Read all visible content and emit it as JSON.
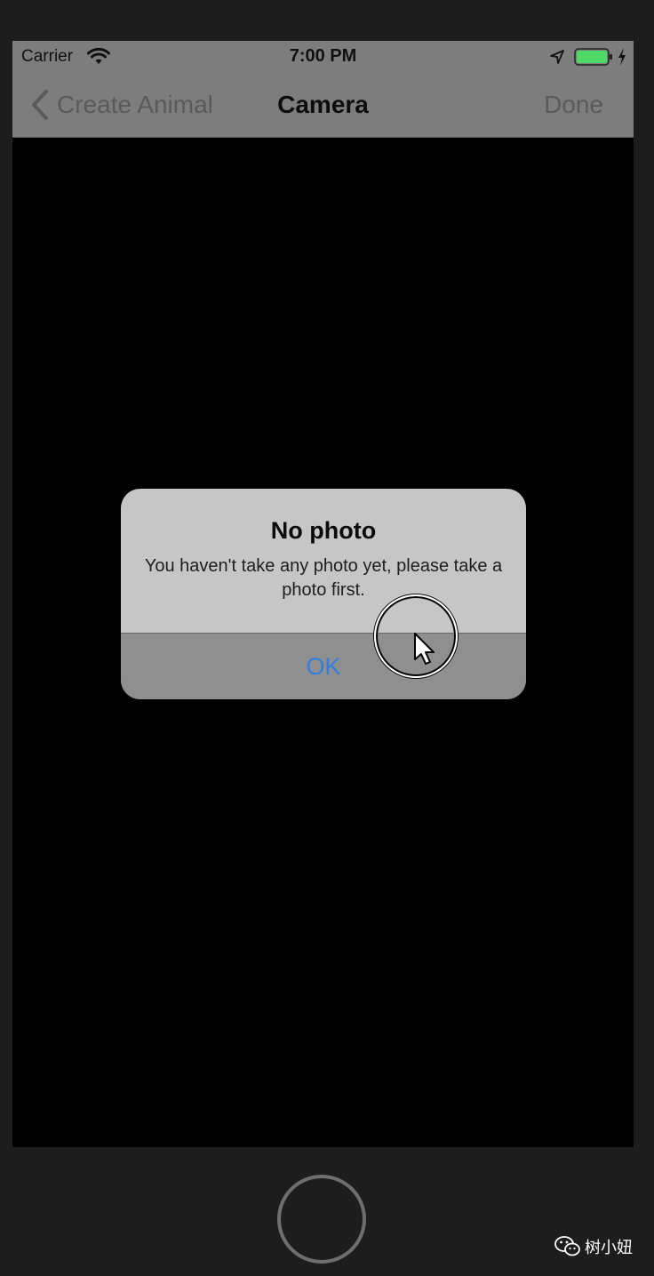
{
  "status_bar": {
    "carrier": "Carrier",
    "time": "7:00 PM",
    "battery_color": "#4cd964"
  },
  "nav_bar": {
    "back_label": "Create Animal",
    "title": "Camera",
    "done_label": "Done"
  },
  "alert": {
    "title": "No photo",
    "message": "You haven't take any photo yet, please take a photo first.",
    "ok_label": "OK",
    "ok_color": "#2f7fe0"
  },
  "watermark": {
    "text": "树小妞"
  },
  "icons": [
    "wifi-icon",
    "location-icon",
    "battery-icon",
    "bolt-icon",
    "chevron-left-icon",
    "cursor-icon",
    "wechat-icon"
  ]
}
